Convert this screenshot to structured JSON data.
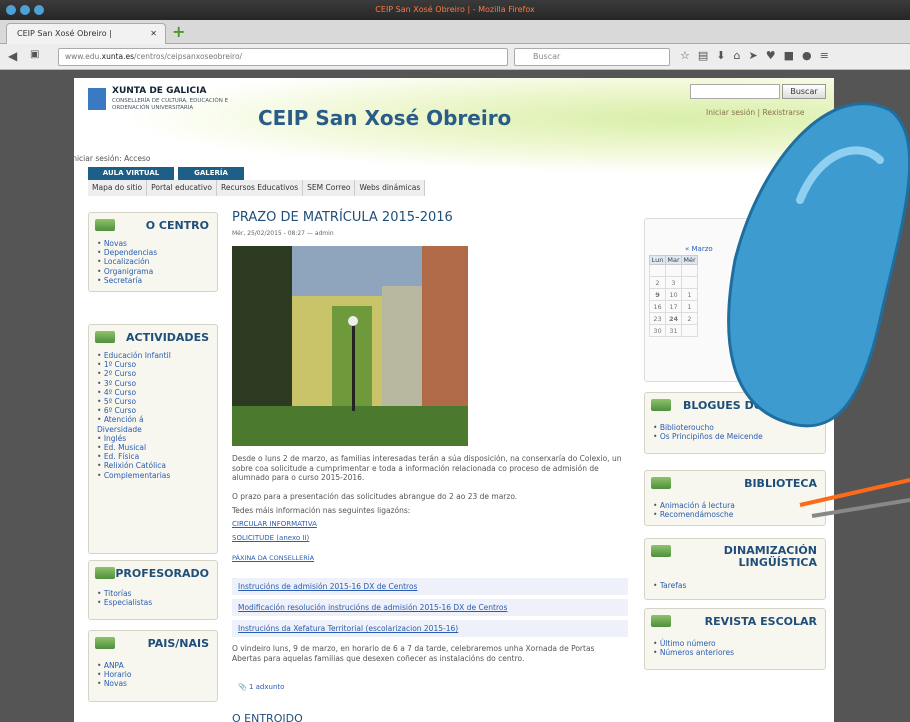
{
  "window": {
    "title": "CEIP San Xosé Obreiro | - Mozilla Firefox"
  },
  "tab": {
    "label": "CEIP San Xosé Obreiro |"
  },
  "url": {
    "prefix": "www.edu.",
    "domain": "xunta.es",
    "path": "/centros/ceipsanxoseobreiro/"
  },
  "search": {
    "placeholder": "Buscar"
  },
  "header": {
    "org": "XUNTA DE GALICIA",
    "dept": "CONSELLERÍA DE CULTURA, EDUCACIÓN E ORDENACIÓN UNIVERSITARIA",
    "site_title": "CEIP San Xosé Obreiro",
    "search_button": "Buscar",
    "login_links": "Iniciar sesión | Rexistrarse",
    "login_access": "Iniciar sesión: Acceso",
    "tab_aula": "AULA VIRTUAL",
    "tab_galeria": "GALERÍA"
  },
  "menu": [
    "Mapa do sitio",
    "Portal educativo",
    "Recursos Educativos",
    "SEM Correo",
    "Webs dinámicas"
  ],
  "left": [
    {
      "title": "O CENTRO",
      "items": [
        "Novas",
        "Dependencias",
        "Localización",
        "Organigrama",
        "Secretaría"
      ]
    },
    {
      "title": "ACTIVIDADES",
      "items": [
        "Educación Infantil",
        "1º Curso",
        "2º Curso",
        "3º Curso",
        "4º Curso",
        "5º Curso",
        "6º Curso",
        "Atención á Diversidade",
        "Inglés",
        "Ed. Musical",
        "Ed. Física",
        "Relixión Católica",
        "Complementarias"
      ]
    },
    {
      "title": "PROFESORADO",
      "items": [
        "Titorías",
        "Especialistas"
      ]
    },
    {
      "title": "PAIS/NAIS",
      "items": [
        "ANPA",
        "Horario",
        "Novas"
      ]
    }
  ],
  "post": {
    "title": "PRAZO DE MATRÍCULA 2015-2016",
    "meta": "Mér, 25/02/2015 - 08:27 — admin",
    "p1": "Desde o luns 2 de marzo, as familias interesadas terán a súa disposición, na conserxaría do Colexio, un sobre coa solicitude a cumprimentar e toda a información relacionada co proceso de admisión de alumnado para o curso 2015-2016.",
    "p2": "O prazo para a presentación das solicitudes abrangue do 2 ao 23 de marzo.",
    "p3": "Tedes máis información nas seguintes ligazóns:",
    "link1": "CIRCULAR INFORMATIVA",
    "link2": "SOLICITUDE (anexo II)",
    "link3": "PÁXINA DA CONSELLERÍA",
    "box1": "Instrucións de admisión 2015-16 DX de Centros",
    "box2": "Modificación resolución instrucións de admisión 2015-16 DX de Centros",
    "box3": "Instrucións da Xefatura Territorial (escolarizacion 2015-16)",
    "p4": "O vindeiro luns, 9 de marzo, en horario de 6 a 7 da tarde, celebraremos unha Xornada de Portas Abertas para aquelas familias que desexen coñecer as instalacións do centro.",
    "attach": "1 adxunto",
    "next": "O ENTROIDO"
  },
  "calendar": {
    "month": "« Marzo",
    "days": [
      "Lun",
      "Mar",
      "Mér"
    ],
    "rows": [
      [
        "2",
        "3",
        ""
      ],
      [
        "9",
        "10",
        "1"
      ],
      [
        "16",
        "17",
        "1"
      ],
      [
        "23",
        "24",
        "2"
      ],
      [
        "30",
        "31",
        ""
      ]
    ]
  },
  "right": [
    {
      "title": "BLOGUES DO CENTRO",
      "items": [
        "Biblioteroucho",
        "Os Principiños de Meicende"
      ]
    },
    {
      "title": "BIBLIOTECA",
      "items": [
        "Animación á lectura",
        "Recomendámosche"
      ]
    },
    {
      "title": "DINAMIZACIÓN LINGÜÍSTICA",
      "items": [
        "Tarefas"
      ]
    },
    {
      "title": "REVISTA ESCOLAR",
      "items": [
        "Último número",
        "Números anteriores"
      ]
    }
  ],
  "colors": {
    "accent": "#1f4e79",
    "link": "#2a5db0",
    "splash": "#3e9bd0",
    "pen_orange": "#ff6a1a"
  }
}
